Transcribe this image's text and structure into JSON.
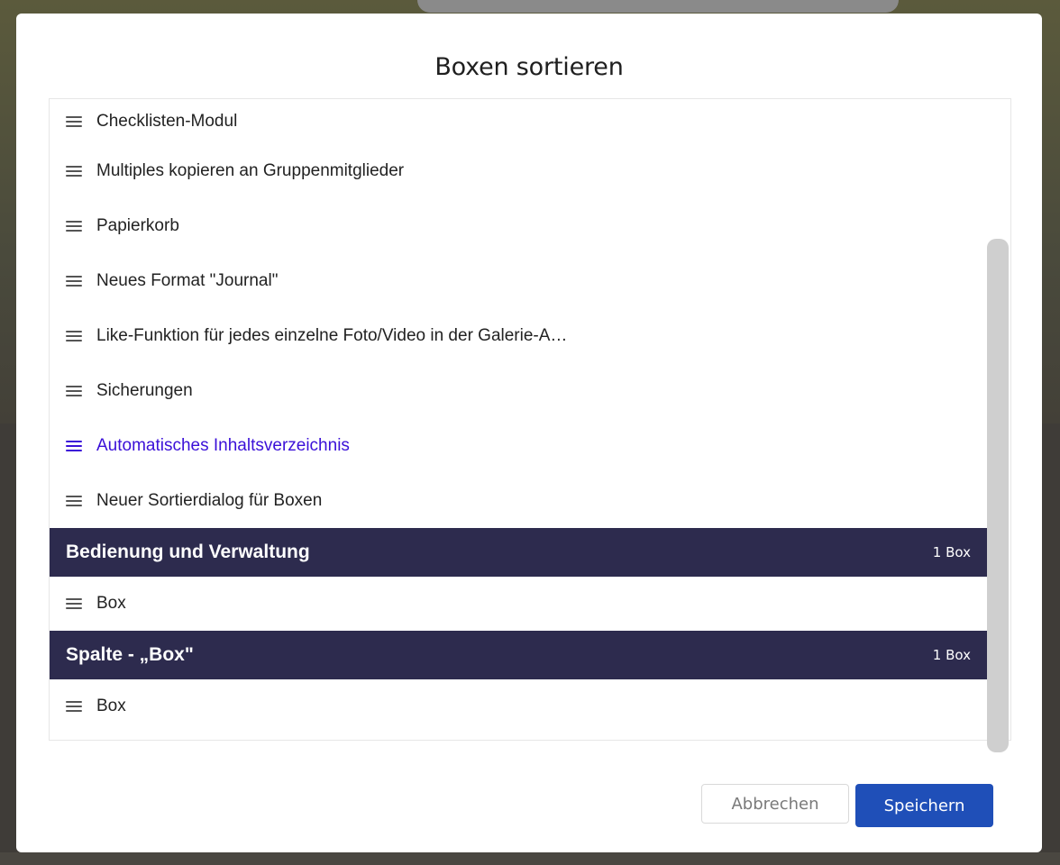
{
  "dialog": {
    "title": "Boxen sortieren",
    "cancel_label": "Abbrechen",
    "save_label": "Speichern"
  },
  "items": [
    "Checklisten-Modul",
    "Multiples kopieren an Gruppenmitglieder",
    "Papierkorb",
    "Neues Format \"Journal\"",
    "Like-Funktion für jedes einzelne Foto/Video in der Galerie-A…",
    "Sicherungen",
    "Automatisches Inhaltsverzeichnis",
    "Neuer Sortierdialog für Boxen"
  ],
  "groups": [
    {
      "title": "Bedienung und Verwaltung",
      "count": "1 Box",
      "items": [
        "Box"
      ]
    },
    {
      "title": "Spalte - „Box\"",
      "count": "1 Box",
      "items": [
        "Box"
      ]
    }
  ],
  "colors": {
    "header_bg": "#2d2b4e",
    "active_item": "#3b10d8",
    "save_button": "#1f4fb8"
  },
  "icons": {
    "drag_handle": "drag-handle-icon"
  }
}
